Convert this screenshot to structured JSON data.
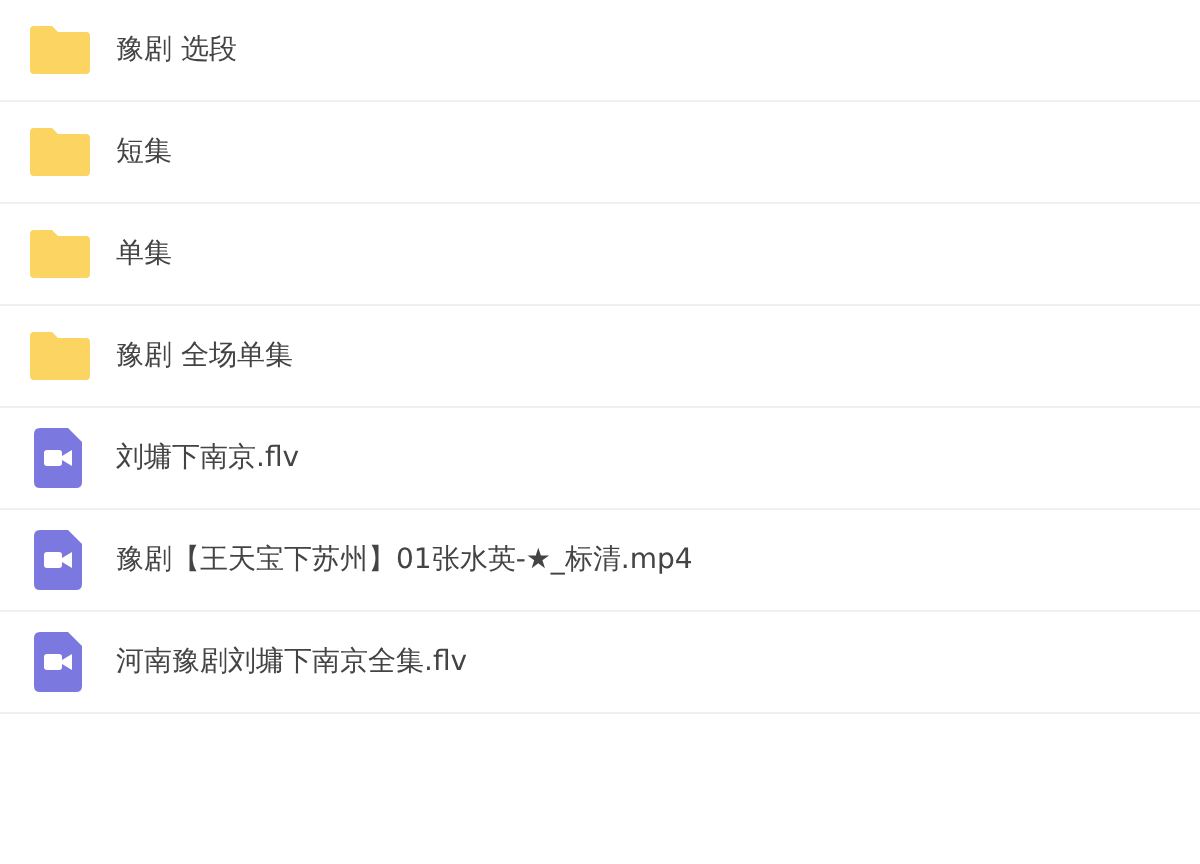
{
  "files": [
    {
      "kind": "folder",
      "name": "豫剧 选段"
    },
    {
      "kind": "folder",
      "name": "短集"
    },
    {
      "kind": "folder",
      "name": "单集"
    },
    {
      "kind": "folder",
      "name": "豫剧 全场单集"
    },
    {
      "kind": "video",
      "name": "刘墉下南京.flv"
    },
    {
      "kind": "video",
      "name": "豫剧【王天宝下苏州】01张水英-★_标清.mp4"
    },
    {
      "kind": "video",
      "name": "河南豫剧刘墉下南京全集.flv"
    }
  ]
}
